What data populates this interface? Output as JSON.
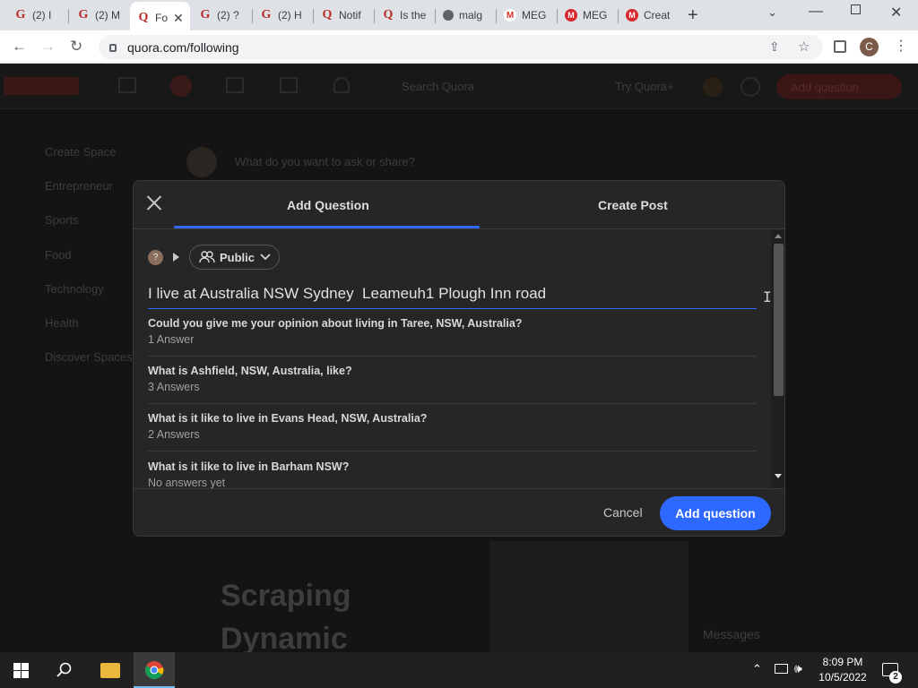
{
  "browser": {
    "tabs": [
      {
        "icon": "quora-icon",
        "title": "(2) I"
      },
      {
        "icon": "quora-icon",
        "title": "(2) M"
      },
      {
        "icon": "quora-icon",
        "title": "Fo",
        "active": true
      },
      {
        "icon": "quora-icon",
        "title": "(2) ?"
      },
      {
        "icon": "quora-icon",
        "title": "(2) H"
      },
      {
        "icon": "quora-icon",
        "title": "Notif"
      },
      {
        "icon": "quora-icon",
        "title": "Is the"
      },
      {
        "icon": "globe-icon",
        "title": "malg"
      },
      {
        "icon": "gmail-icon",
        "title": "MEG"
      },
      {
        "icon": "mega-icon",
        "title": "MEG"
      },
      {
        "icon": "mega-icon",
        "title": "Creat"
      }
    ],
    "url": "quora.com/following",
    "profile_initial": "C"
  },
  "background": {
    "search_placeholder": "Search Quora",
    "try_label": "Try Quora+",
    "add_question_label": "Add question",
    "composer_placeholder": "What do you want to ask or share?",
    "sidebar": [
      "Create Space",
      "Entrepreneur",
      "Sports",
      "Food",
      "Technology",
      "Health",
      "Discover Spaces"
    ],
    "video_text": [
      "Scraping",
      "Dynamic"
    ],
    "messages_label": "Messages"
  },
  "modal": {
    "tabs": [
      "Add Question",
      "Create Post"
    ],
    "audience_label": "Public",
    "avatar_text": "?",
    "question_value": "I live at Australia NSW Sydney  Leameuh1 Plough Inn road",
    "suggestions": [
      {
        "title": "Could you give me your opinion about living in Taree, NSW, Australia?",
        "count": "1 Answer"
      },
      {
        "title": "What is Ashfield, NSW, Australia, like?",
        "count": "3 Answers"
      },
      {
        "title": "What is it like to live in Evans Head, NSW, Australia?",
        "count": "2 Answers"
      },
      {
        "title": "What is it like to live in Barham NSW?",
        "count": "No answers yet"
      }
    ],
    "cancel_label": "Cancel",
    "submit_label": "Add question"
  },
  "taskbar": {
    "time": "8:09 PM",
    "date": "10/5/2022",
    "notification_count": "2"
  },
  "colors": {
    "accent": "#2e69ff",
    "quora_red": "#b92b27"
  }
}
